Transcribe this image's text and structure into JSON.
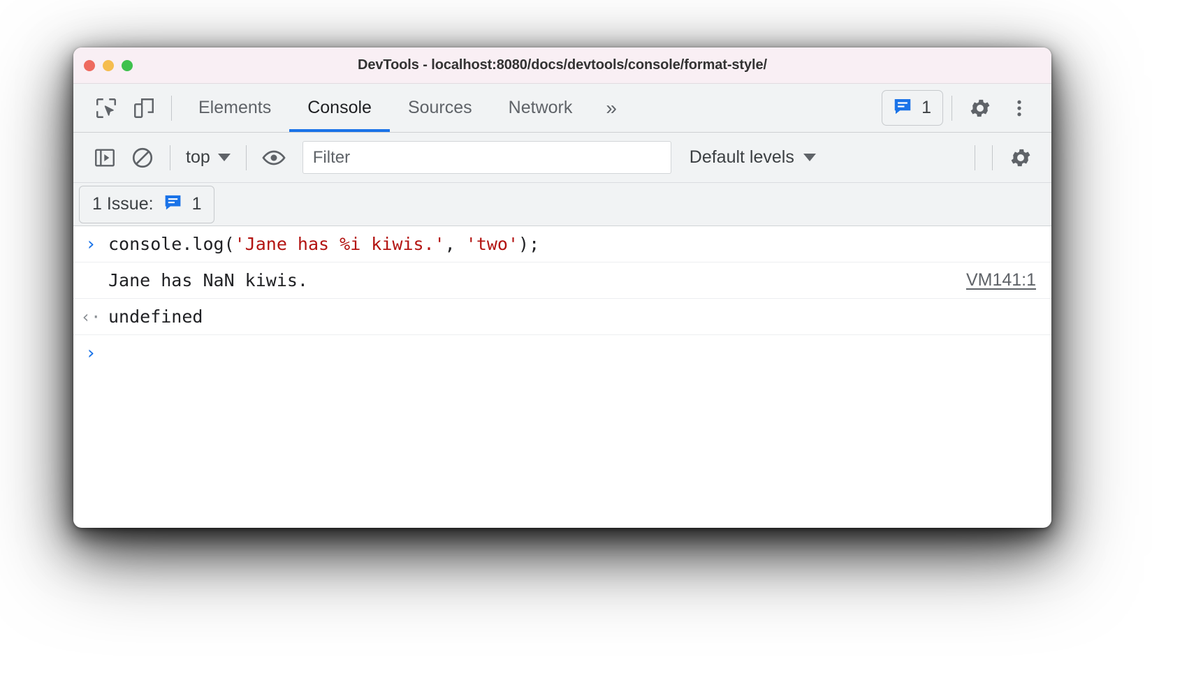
{
  "window": {
    "title": "DevTools - localhost:8080/docs/devtools/console/format-style/",
    "traffic_lights": [
      "close-red",
      "minimize-yellow",
      "maximize-green"
    ],
    "colors": {
      "titlebar_bg": "#f9eff4",
      "toolbar_bg": "#f1f3f4",
      "accent_blue": "#1a73e8",
      "string_red": "#b31412",
      "muted_gray": "#9aa0a6"
    }
  },
  "tabbar": {
    "inspect_icon": "inspect-element-icon",
    "device_icon": "device-toolbar-icon",
    "tabs": [
      {
        "label": "Elements",
        "active": false
      },
      {
        "label": "Console",
        "active": true
      },
      {
        "label": "Sources",
        "active": false
      },
      {
        "label": "Network",
        "active": false
      }
    ],
    "more_tabs": "»",
    "issues_badge": {
      "icon": "issues-speech-bubble-icon",
      "count": "1"
    },
    "settings_icon": "gear-icon",
    "menu_icon": "kebab-menu-icon"
  },
  "console_toolbar": {
    "sidebar_toggle_icon": "console-sidebar-icon",
    "clear_icon": "clear-console-icon",
    "context": {
      "label": "top",
      "caret": "chevron-down-icon"
    },
    "eye_icon": "live-expression-eye-icon",
    "filter": {
      "placeholder": "Filter",
      "value": ""
    },
    "levels": {
      "label": "Default levels",
      "caret": "chevron-down-icon"
    },
    "settings_icon": "console-settings-gear-icon"
  },
  "issues_banner": {
    "label": "1 Issue:",
    "badge_icon": "issues-speech-bubble-icon",
    "count": "1"
  },
  "console_rows": [
    {
      "type": "input",
      "gutter": "›",
      "segments": [
        {
          "text": "console.log(",
          "style": "plain"
        },
        {
          "text": "'Jane has %i kiwis.'",
          "style": "str"
        },
        {
          "text": ", ",
          "style": "plain"
        },
        {
          "text": "'two'",
          "style": "str"
        },
        {
          "text": ");",
          "style": "plain"
        }
      ],
      "vmlink": ""
    },
    {
      "type": "result",
      "gutter": "",
      "segments": [
        {
          "text": "Jane has NaN kiwis.",
          "style": "plain"
        }
      ],
      "vmlink": "VM141:1"
    },
    {
      "type": "eval",
      "gutter": "‹·",
      "segments": [
        {
          "text": "undefined",
          "style": "plain"
        }
      ],
      "vmlink": ""
    },
    {
      "type": "prompt",
      "gutter": "›",
      "segments": [],
      "vmlink": ""
    }
  ]
}
